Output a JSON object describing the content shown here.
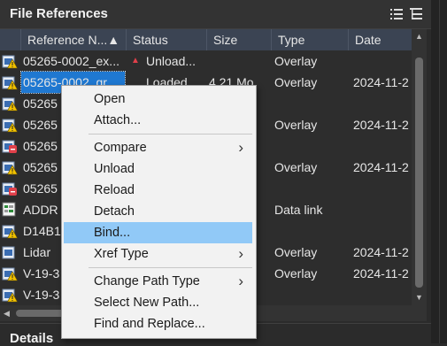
{
  "panel": {
    "title": "File References",
    "list_icon": "list-view-icon",
    "tree_icon": "tree-view-icon"
  },
  "columns": [
    {
      "label": "Reference N...▲"
    },
    {
      "label": "Status"
    },
    {
      "label": "Size"
    },
    {
      "label": "Type"
    },
    {
      "label": "Date"
    }
  ],
  "rows": [
    {
      "name": "05265-0002_ex...",
      "status": "Unload...",
      "size": "",
      "type": "Overlay",
      "date": "",
      "icon": "dwg-warning-icon",
      "status_icon": "unloaded-arrow-icon",
      "selected": false
    },
    {
      "name": "05265-0002_gr...",
      "status": "Loaded",
      "size": "4.21 Mo",
      "type": "Overlay",
      "date": "2024-11-2",
      "icon": "dwg-warning-icon",
      "status_icon": "",
      "selected": true
    },
    {
      "name": "05265",
      "status": "",
      "size": "",
      "type": "",
      "date": "",
      "icon": "dwg-warning-icon",
      "status_icon": "",
      "selected": false
    },
    {
      "name": "05265",
      "status": "",
      "size": "",
      "type": "Overlay",
      "date": "2024-11-2",
      "icon": "dwg-warning-icon",
      "status_icon": "",
      "selected": false
    },
    {
      "name": "05265",
      "status": "",
      "size": "",
      "type": "",
      "date": "",
      "icon": "dwg-error-icon",
      "status_icon": "",
      "selected": false
    },
    {
      "name": "05265",
      "status": "",
      "size": "",
      "type": "Overlay",
      "date": "2024-11-2",
      "icon": "dwg-warning-icon",
      "status_icon": "",
      "selected": false
    },
    {
      "name": "05265",
      "status": "",
      "size": "",
      "type": "",
      "date": "",
      "icon": "dwg-error-icon",
      "status_icon": "",
      "selected": false
    },
    {
      "name": "ADDR",
      "status": "",
      "size": "",
      "type": "Data link",
      "date": "",
      "icon": "data-link-icon",
      "status_icon": "",
      "selected": false
    },
    {
      "name": "D14B1",
      "status": "",
      "size": "",
      "type": "",
      "date": "",
      "icon": "dwg-warning-icon",
      "status_icon": "",
      "selected": false
    },
    {
      "name": "Lidar",
      "status": "",
      "size": "",
      "type": "Overlay",
      "date": "2024-11-2",
      "icon": "dwg-icon",
      "status_icon": "",
      "selected": false
    },
    {
      "name": "V-19-3",
      "status": "",
      "size": "",
      "type": "Overlay",
      "date": "2024-11-2",
      "icon": "dwg-warning-icon",
      "status_icon": "",
      "selected": false
    },
    {
      "name": "V-19-3",
      "status": "",
      "size": "",
      "type": "",
      "date": "",
      "icon": "dwg-warning-icon",
      "status_icon": "",
      "selected": false
    }
  ],
  "context_menu": {
    "items": [
      {
        "label": "Open",
        "submenu": false,
        "highlighted": false,
        "sep_before": false
      },
      {
        "label": "Attach...",
        "submenu": false,
        "highlighted": false,
        "sep_before": false
      },
      {
        "label": "Compare",
        "submenu": true,
        "highlighted": false,
        "sep_before": true
      },
      {
        "label": "Unload",
        "submenu": false,
        "highlighted": false,
        "sep_before": false
      },
      {
        "label": "Reload",
        "submenu": false,
        "highlighted": false,
        "sep_before": false
      },
      {
        "label": "Detach",
        "submenu": false,
        "highlighted": false,
        "sep_before": false
      },
      {
        "label": "Bind...",
        "submenu": false,
        "highlighted": true,
        "sep_before": false
      },
      {
        "label": "Xref Type",
        "submenu": true,
        "highlighted": false,
        "sep_before": false
      },
      {
        "label": "Change Path Type",
        "submenu": true,
        "highlighted": false,
        "sep_before": true
      },
      {
        "label": "Select New Path...",
        "submenu": false,
        "highlighted": false,
        "sep_before": false
      },
      {
        "label": "Find and Replace...",
        "submenu": false,
        "highlighted": false,
        "sep_before": false
      }
    ]
  },
  "details": {
    "title": "Details"
  },
  "colors": {
    "header_bg": "#3b4453",
    "selection": "#1f78d1",
    "menu_highlight": "#91c9f7",
    "warning": "#f2c200",
    "error": "#e0404a"
  }
}
